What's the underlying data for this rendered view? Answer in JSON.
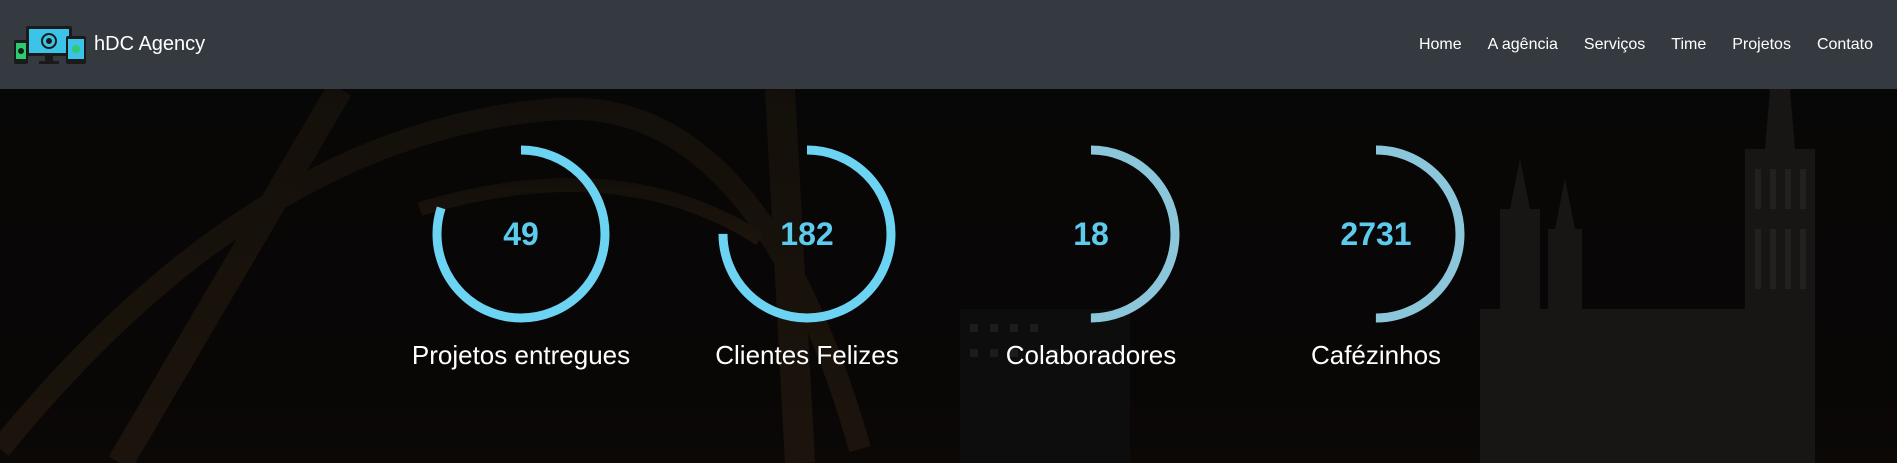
{
  "brand": {
    "name": "hDC Agency",
    "logo_icon": "responsive-devices-icon",
    "colors": {
      "device_frame": "#1a1a1a",
      "screen": "#3cc3e8",
      "accent": "#2ecc71"
    }
  },
  "nav": {
    "items": [
      {
        "label": "Home"
      },
      {
        "label": "A agência"
      },
      {
        "label": "Serviços"
      },
      {
        "label": "Time"
      },
      {
        "label": "Projetos"
      },
      {
        "label": "Contato"
      }
    ]
  },
  "stats": [
    {
      "value": "49",
      "label": "Projetos entregues",
      "fraction": 0.8,
      "color": "#6dd3f2"
    },
    {
      "value": "182",
      "label": "Clientes Felizes",
      "fraction": 0.75,
      "color": "#6dd3f2"
    },
    {
      "value": "18",
      "label": "Colaboradores",
      "fraction": 0.5,
      "color": "#8cc6da"
    },
    {
      "value": "2731",
      "label": "Cafézinhos",
      "fraction": 0.5,
      "color": "#8cc6da"
    }
  ],
  "theme": {
    "navbar_bg": "#343a40",
    "stat_text": "#5ccbee"
  }
}
